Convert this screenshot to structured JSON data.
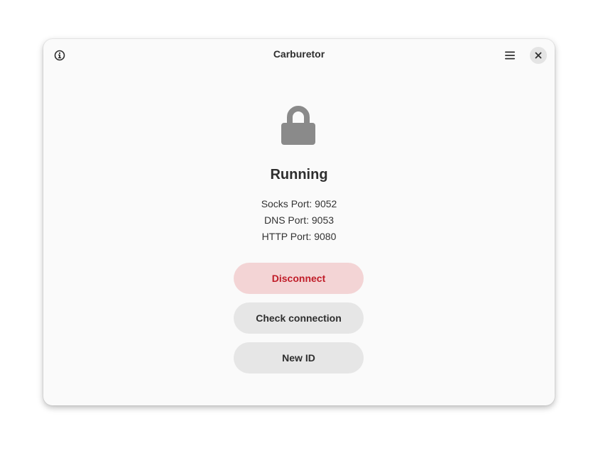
{
  "window": {
    "title": "Carburetor"
  },
  "headerbar": {
    "about_icon": "info-icon",
    "menu_icon": "hamburger-menu-icon",
    "close_icon": "close-icon"
  },
  "status": {
    "icon": "lock-icon",
    "title": "Running",
    "ports": [
      "Socks Port: 9052",
      "DNS Port: 9053",
      "HTTP Port: 9080"
    ]
  },
  "actions": {
    "disconnect_label": "Disconnect",
    "check_connection_label": "Check connection",
    "new_id_label": "New ID"
  },
  "colors": {
    "destructive_text": "#c01c28",
    "destructive_bg": "#f3d4d5",
    "button_bg": "#e6e6e6",
    "window_bg": "#fafafa"
  }
}
